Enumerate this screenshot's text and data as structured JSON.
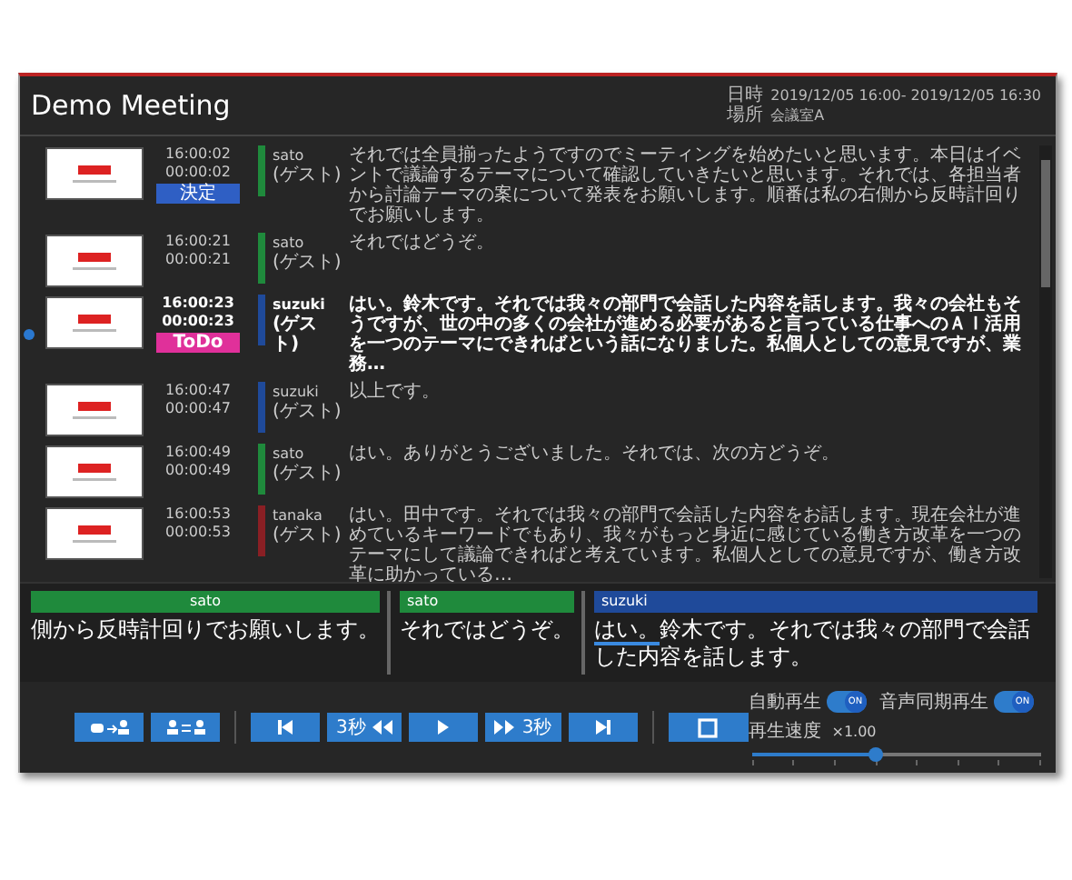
{
  "window": {
    "title": "Demo Meeting",
    "info": [
      {
        "label": "日時",
        "value": "2019/12/05 16:00- 2019/12/05 16:30"
      },
      {
        "label": "場所",
        "value": "会議室A"
      }
    ]
  },
  "utterances": [
    {
      "clock": "16:00:02",
      "elapsed": "00:00:02",
      "badge": {
        "text": "決定",
        "color": "#2f5fc4"
      },
      "speaker": "sato",
      "role": "(ゲスト)",
      "color": "#1f8a3c",
      "selected": false,
      "text": "それでは全員揃ったようですのでミーティングを始めたいと思います。本日はイベントで議論するテーマについて確認していきたいと思います。それでは、各担当者から討論テーマの案について発表をお願いします。順番は私の右側から反時計回りでお願いします。"
    },
    {
      "clock": "16:00:21",
      "elapsed": "00:00:21",
      "speaker": "sato",
      "role": "(ゲスト)",
      "color": "#1f8a3c",
      "selected": false,
      "text": "それではどうぞ。"
    },
    {
      "clock": "16:00:23",
      "elapsed": "00:00:23",
      "badge": {
        "text": "ToDo",
        "color": "#e0309a"
      },
      "speaker": "suzuki",
      "role": "(ゲスト)",
      "color": "#1f4a9a",
      "selected": true,
      "text": "はい。鈴木です。それでは我々の部門で会話した内容を話します。我々の会社もそうですが、世の中の多くの会社が進める必要があると言っている仕事へのＡＩ活用を一つのテーマにできればという話になりました。私個人としての意見ですが、業務…"
    },
    {
      "clock": "16:00:47",
      "elapsed": "00:00:47",
      "speaker": "suzuki",
      "role": "(ゲスト)",
      "color": "#1f4a9a",
      "selected": false,
      "text": "以上です。"
    },
    {
      "clock": "16:00:49",
      "elapsed": "00:00:49",
      "speaker": "sato",
      "role": "(ゲスト)",
      "color": "#1f8a3c",
      "selected": false,
      "text": "はい。ありがとうございました。それでは、次の方どうぞ。"
    },
    {
      "clock": "16:00:53",
      "elapsed": "00:00:53",
      "speaker": "tanaka",
      "role": "(ゲスト)",
      "color": "#8a1f24",
      "selected": false,
      "text": "はい。田中です。それでは我々の部門で会話した内容をお話します。現在会社が進めているキーワードでもあり、我々がもっと身近に感じている働き方改革を一つのテーマにして議論できればと考えています。私個人としての意見ですが、働き方改革に助かっている…"
    }
  ],
  "timeline": [
    {
      "speaker": "sato",
      "color": "#1f8a3c",
      "parts": [
        {
          "text": "側から反時計回りでお願いします。",
          "current": false
        }
      ]
    },
    {
      "speaker": "sato",
      "color": "#1f8a3c",
      "parts": [
        {
          "text": "それではどうぞ。",
          "current": false
        }
      ]
    },
    {
      "speaker": "suzuki",
      "color": "#1f4a9a",
      "parts": [
        {
          "text": "はい。",
          "current": true
        },
        {
          "text": "鈴木です。それでは我々の部門で会話した内容を話します。",
          "current": false
        }
      ]
    }
  ],
  "controls": [
    {
      "kind": "speech-to-person"
    },
    {
      "kind": "swap-people"
    },
    {
      "kind": "gap"
    },
    {
      "kind": "to-start"
    },
    {
      "kind": "back",
      "label": "3秒"
    },
    {
      "kind": "play"
    },
    {
      "kind": "forward",
      "label": "3秒"
    },
    {
      "kind": "to-end"
    },
    {
      "kind": "gap"
    },
    {
      "kind": "stop"
    }
  ],
  "settings": {
    "toggles": [
      {
        "label": "自動再生",
        "on": true,
        "state_label": "ON"
      },
      {
        "label": "音声同期再生",
        "on": true,
        "state_label": "ON"
      }
    ],
    "speed": {
      "label": "再生速度",
      "value": "×1.00",
      "level": 0.43
    }
  }
}
